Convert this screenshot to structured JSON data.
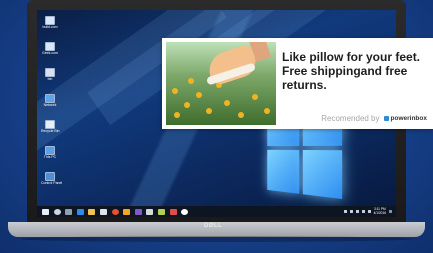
{
  "desktop": {
    "icons": [
      {
        "label": "build.com"
      },
      {
        "label": "Geek.com"
      },
      {
        "label": "bin"
      },
      {
        "label": "Network"
      },
      {
        "label": "Recycle Bin"
      },
      {
        "label": "This PC"
      },
      {
        "label": "Control Panel"
      }
    ]
  },
  "taskbar": {
    "clock_time": "3:11 PM",
    "clock_date": "4/1/2016"
  },
  "laptop": {
    "brand": "DØLL"
  },
  "ad": {
    "headline": "Like pillow for your feet. Free shippingand free returns.",
    "recommended_label": "Recomended by",
    "provider_name": "powerinbox"
  },
  "colors": {
    "page_background": "#17418c",
    "ad_background": "#ffffff",
    "taskbar": "#0e1522",
    "accent": "#2f8bd6"
  }
}
